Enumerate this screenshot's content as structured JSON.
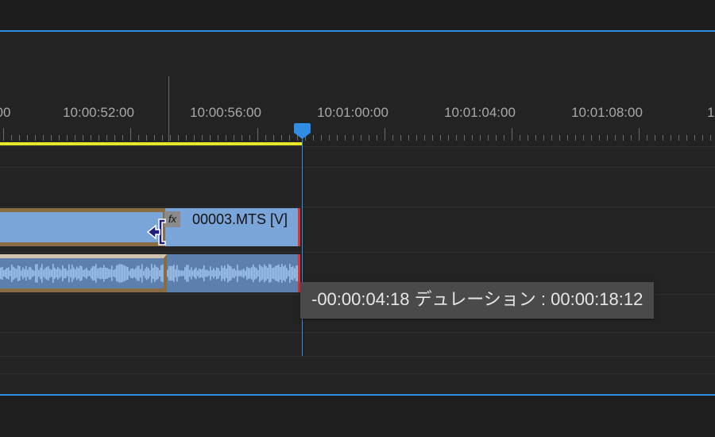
{
  "ruler": {
    "labels": [
      "00",
      "10:00:52:00",
      "10:00:56:00",
      "10:01:00:00",
      "10:01:04:00",
      "10:01:08:00",
      "10:0"
    ]
  },
  "clip": {
    "video_label": "00003.MTS [V]",
    "fx_badge": "fx"
  },
  "tooltip": {
    "text": "-00:00:04:18 デュレーション : 00:00:18:12"
  },
  "colors": {
    "accent": "#2f8de4",
    "work_area": "#e5e52a",
    "video_clip": "#7aa5d8",
    "audio_clip": "#5d7fae",
    "selection_border": "#8a6c44",
    "edit_marker": "#e03030"
  },
  "icons": {
    "playhead": "playhead-icon",
    "trim_cursor": "ripple-trim-cursor-icon",
    "fx": "fx-icon"
  }
}
